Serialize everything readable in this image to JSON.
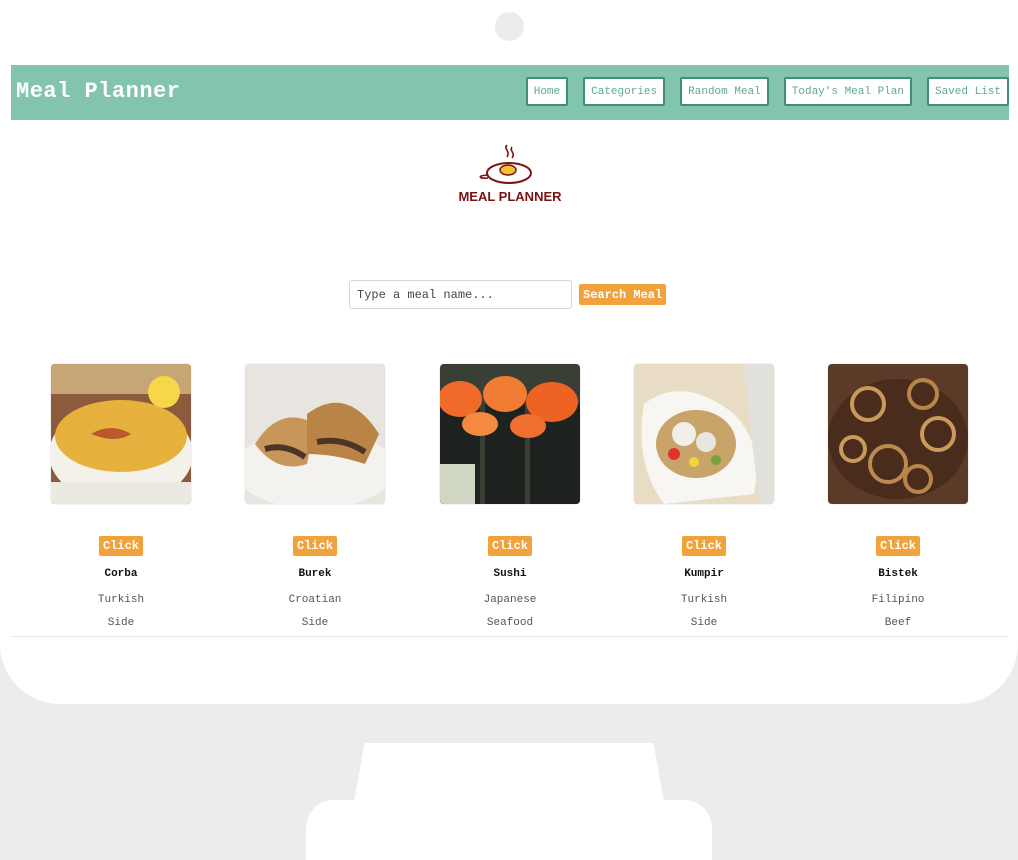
{
  "header": {
    "title": "Meal Planner",
    "nav": [
      "Home",
      "Categories",
      "Random Meal",
      "Today's Meal Plan",
      "Saved List"
    ]
  },
  "logo": {
    "text": "MEAL PLANNER"
  },
  "search": {
    "placeholder": "Type a meal name...",
    "button": "Search Meal"
  },
  "meals": [
    {
      "name": "Corba",
      "area": "Turkish",
      "category": "Side",
      "button": "Click",
      "image": "lentil-soup-image"
    },
    {
      "name": "Burek",
      "area": "Croatian",
      "category": "Side",
      "button": "Click",
      "image": "burek-pastry-image"
    },
    {
      "name": "Sushi",
      "area": "Japanese",
      "category": "Seafood",
      "button": "Click",
      "image": "sushi-rolls-image"
    },
    {
      "name": "Kumpir",
      "area": "Turkish",
      "category": "Side",
      "button": "Click",
      "image": "stuffed-potato-image"
    },
    {
      "name": "Bistek",
      "area": "Filipino",
      "category": "Beef",
      "button": "Click",
      "image": "beef-onions-image"
    }
  ],
  "colors": {
    "header_bg": "#82c4ae",
    "accent": "#f2a23a",
    "logo": "#7a1414"
  }
}
